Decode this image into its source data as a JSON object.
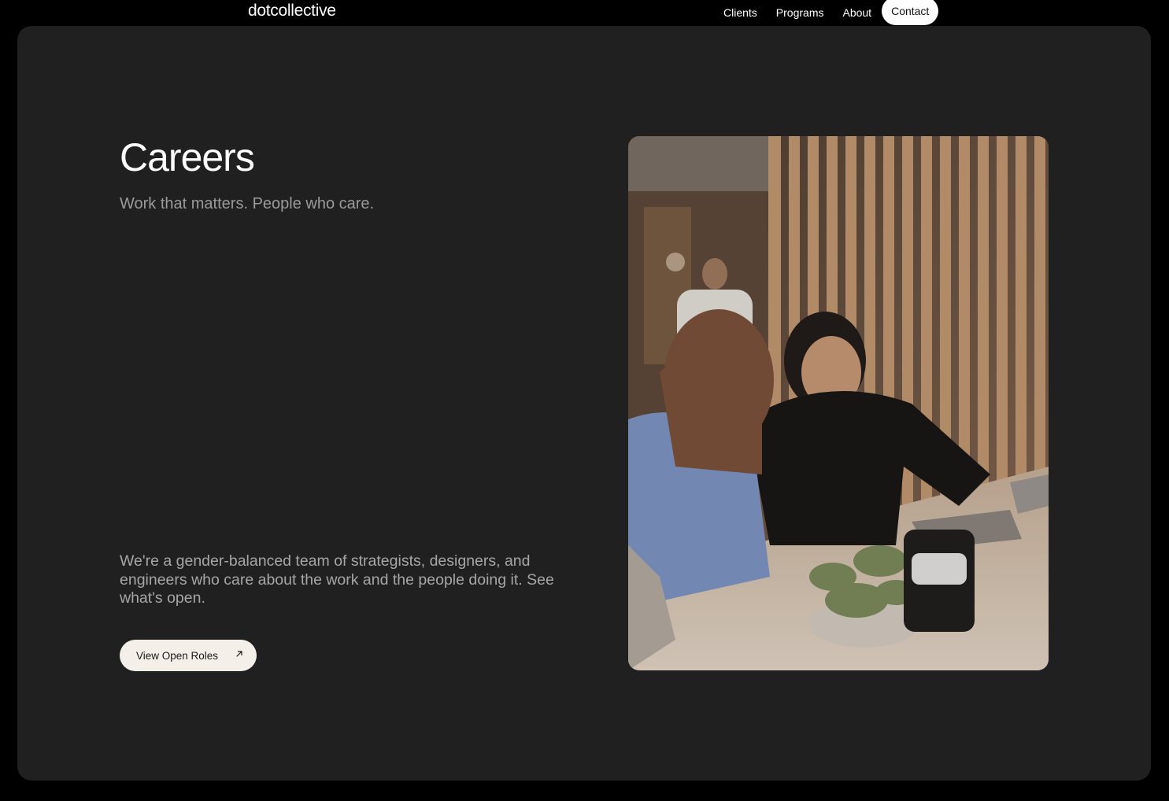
{
  "brand": {
    "logo_text": "dotcollective"
  },
  "nav": {
    "items": [
      {
        "label": "Clients"
      },
      {
        "label": "Programs"
      },
      {
        "label": "About"
      }
    ],
    "contact_label": "Contact"
  },
  "hero": {
    "title": "Careers",
    "subtitle": "Work that matters. People who care.",
    "body": "We're a gender-balanced team of strategists, designers, and engineers who care about the work and the people doing it. See what's open.",
    "cta_label": "View Open Roles",
    "cta_icon": "arrow-up-right-icon",
    "photo": "team-at-desk-photo"
  },
  "colors": {
    "page_bg": "#000000",
    "card_bg": "#202020",
    "cta_bg": "#f4efe9",
    "text_primary": "#ffffff",
    "text_muted": "#9a9a9a"
  }
}
